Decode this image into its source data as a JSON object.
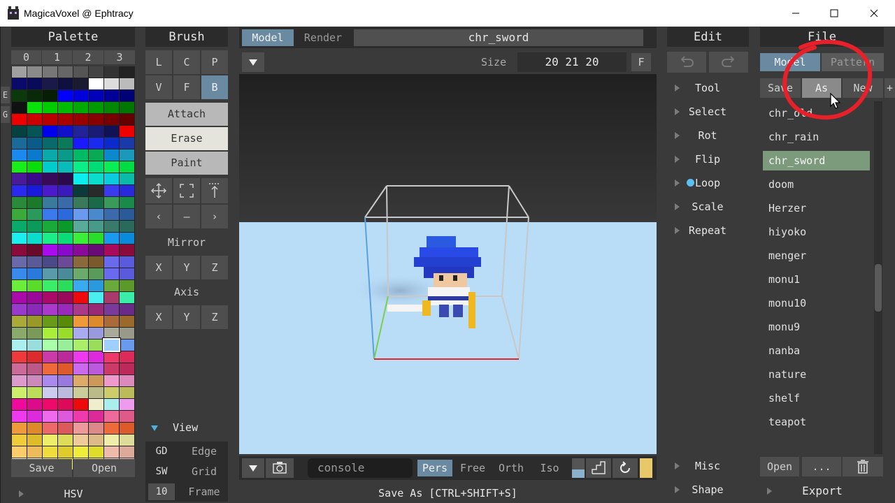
{
  "window": {
    "title": "MagicaVoxel @ Ephtracy"
  },
  "palette": {
    "title": "Palette",
    "tabs": [
      "0",
      "1",
      "2",
      "3"
    ],
    "side_tabs": [
      "E",
      "G"
    ],
    "colors": [
      [
        "#a0a0a0",
        "#8a8a8a",
        "#777777",
        "#666666",
        "#555555",
        "#444444",
        "#333333",
        "#222222"
      ],
      [
        "#0a0a6a",
        "#0a0a5a",
        "#1a1a4a",
        "#101040",
        "#1a1a30",
        "#ffffff",
        "#dddddd",
        "#bbbbbb"
      ],
      [
        "#0a3a0a",
        "#082a08",
        "#061e06",
        "#0000ff",
        "#0000dd",
        "#0000bb",
        "#000099",
        "#000077"
      ],
      [
        "#111111",
        "#0ae00a",
        "#00cc00",
        "#00bb00",
        "#00aa00",
        "#009900",
        "#008800",
        "#007700"
      ],
      [
        "#ee0000",
        "#cc0000",
        "#bb0000",
        "#aa0000",
        "#990000",
        "#880000",
        "#770000",
        "#660000"
      ],
      [
        "#064040",
        "#055555",
        "#0000ee",
        "#1111cc",
        "#222299",
        "#1a1a77",
        "#111155",
        "#ee0000"
      ],
      [
        "#1a6a9a",
        "#0a5a8a",
        "#086a6a",
        "#0a7a5a",
        "#1a1aff",
        "#1a2aee",
        "#0a2acc",
        "#1a3aaa"
      ],
      [
        "#1a8aee",
        "#0a7acc",
        "#0aaaaa",
        "#0a9a8a",
        "#00bb66",
        "#0aaa55",
        "#0a8acc",
        "#1a99bb"
      ],
      [
        "#1aee1a",
        "#0add0a",
        "#00cccc",
        "#0abbbb",
        "#0aee88",
        "#00dd77",
        "#0aee55",
        "#00dd44"
      ],
      [
        "#4a1a9a",
        "#3a0a8a",
        "#3a0a5a",
        "#2a0a4a",
        "#0aeeee",
        "#0addcc",
        "#0accdd",
        "#0abbaa"
      ],
      [
        "#2a2aee",
        "#1a1add",
        "#4a1acc",
        "#3a1abb",
        "#0a3a3a",
        "#2a2a2a",
        "#3a3aee",
        "#2a2add"
      ],
      [
        "#2a8a3a",
        "#1a7a2a",
        "#3a7a9a",
        "#3a6aaa",
        "#3a7a5a",
        "#1a6a4a",
        "#3a9a5a",
        "#1a8a4a"
      ],
      [
        "#3aaa3a",
        "#2a9a5a",
        "#3a7aee",
        "#2a6add",
        "#6a9aee",
        "#4a8acc",
        "#3a6aaa",
        "#2a5a99"
      ],
      [
        "#0aaa6a",
        "#0a9a5a",
        "#1aaa3a",
        "#0a9a2a",
        "#5aaa9a",
        "#4a9a8a",
        "#3a7a6a",
        "#2a6a5a"
      ],
      [
        "#1aeeee",
        "#0addcc",
        "#1aee88",
        "#0add77",
        "#3aee3a",
        "#2add2a",
        "#1a9aee",
        "#0a8add"
      ],
      [
        "#8a0a3a",
        "#6a0a2a",
        "#aa0aee",
        "#8a0acc",
        "#8a0a99",
        "#6a0a77",
        "#aa0a5a",
        "#8a0a3a"
      ],
      [
        "#6a6aaa",
        "#5a5a99",
        "#4a4a88",
        "#6a4a99",
        "#8a6a3a",
        "#7a5a2a",
        "#6a6aee",
        "#5a5add"
      ],
      [
        "#3a8aee",
        "#2a7add",
        "#5a9aaa",
        "#4a8a99",
        "#6aaa6a",
        "#5a9a5a",
        "#6a6aee",
        "#5a5add"
      ],
      [
        "#6aee3a",
        "#5add2a",
        "#3aee6a",
        "#2add5a",
        "#3aaaee",
        "#2a99dd",
        "#6aaa3a",
        "#5a992a"
      ],
      [
        "#aa0aaa",
        "#990a99",
        "#aa0a6a",
        "#990a5a",
        "#ee0a0a",
        "#4aeeee",
        "#aa3a6a",
        "#3aeeaa"
      ],
      [
        "#9a3acc",
        "#8a2abb",
        "#aa3acc",
        "#9a2abb",
        "#aa3a88",
        "#9a2a77",
        "#7a3a9a",
        "#6a2a88"
      ],
      [
        "#aaaa3a",
        "#99992a",
        "#6a9a1a",
        "#5a8a0a",
        "#ee9a3a",
        "#dd8a2a",
        "#aa6a3a",
        "#996a2a"
      ],
      [
        "#8aaa6a",
        "#7a9a5a",
        "#aaee3a",
        "#99dd2a",
        "#aaaaee",
        "#9999dd",
        "#aaaa9a",
        "#99998a"
      ],
      [
        "#aaeeee",
        "#99dddd",
        "#aaffaa",
        "#99ee99",
        "#aaee6a",
        "#99dd5a",
        "#9fcfff",
        "#6a9aee"
      ],
      [
        "#ee3a3a",
        "#dd2a2a",
        "#cc3aaa",
        "#bb2a99",
        "#ee3aee",
        "#dd2add",
        "#ee3a6a",
        "#dd2a5a"
      ],
      [
        "#cc6a9a",
        "#bb5a89",
        "#ee6a3a",
        "#dd5a2a",
        "#cc6aee",
        "#bb5add",
        "#cc3a6a",
        "#bb2a5a"
      ],
      [
        "#dd9acc",
        "#cc89bb",
        "#aa8aee",
        "#9979dd",
        "#ddaa6a",
        "#cc995a",
        "#ee9acc",
        "#dd89bb"
      ],
      [
        "#ccee6a",
        "#bbdd5a",
        "#ccccee",
        "#bbbbdd",
        "#cccc9a",
        "#bbbb89",
        "#cccc6a",
        "#bbbb5a"
      ],
      [
        "#ee0a9a",
        "#dd0a89",
        "#ee0a6a",
        "#dd0a5a",
        "#ee0a0a",
        "#eeeecc",
        "#aaeeee",
        "#ee9aee"
      ],
      [
        "#ee3aee",
        "#dd2add",
        "#ee6aee",
        "#dd5add",
        "#ee3aaa",
        "#dd2a99",
        "#ee6a9a",
        "#dd5a89"
      ],
      [
        "#ee9a3a",
        "#dd8a2a",
        "#ee6a6a",
        "#dd5a5a",
        "#ee9a9a",
        "#dd8989",
        "#ee6a3a",
        "#dd5a2a"
      ],
      [
        "#eecc3a",
        "#ddbb2a",
        "#eeee6a",
        "#dddd5a",
        "#eecc9a",
        "#ddbb89",
        "#eeeeaa",
        "#dddd99"
      ],
      [
        "#ffcc6a",
        "#eebb5a",
        "#eedd3a",
        "#ddcc2a",
        "#eeee3a",
        "#dddd2a",
        "#eebbaa",
        "#ddaa99"
      ],
      [
        "#ffffff",
        "#ffffee",
        "#eeeecc",
        "#ffff6a",
        "#ffeeaa",
        "#ffee99",
        "#ffdddd",
        "#eecccc"
      ]
    ],
    "selected": {
      "row": 23,
      "col": 6
    },
    "save_label": "Save",
    "open_label": "Open",
    "hsv_label": "HSV"
  },
  "brush": {
    "title": "Brush",
    "types_row1": [
      "L",
      "C",
      "P"
    ],
    "types_row2": [
      "V",
      "F",
      "B"
    ],
    "modes": [
      "Attach",
      "Erase",
      "Paint"
    ],
    "mirror_label": "Mirror",
    "axis_label": "Axis",
    "xyz": [
      "X",
      "Y",
      "Z"
    ],
    "view": {
      "label": "View",
      "rows": [
        {
          "key": "GD",
          "value": "Edge"
        },
        {
          "key": "SW",
          "value": "Grid"
        },
        {
          "key": "10",
          "value": "Frame"
        }
      ]
    }
  },
  "viewport": {
    "tab_model": "Model",
    "tab_render": "Render",
    "model_name": "chr_sword",
    "size_label": "Size",
    "size_value": "20 21 20",
    "fit_label": "F",
    "console_placeholder": "console",
    "cam_modes": [
      "Pers",
      "Free",
      "Orth",
      "Iso"
    ],
    "status": "Save As [CTRL+SHIFT+S]"
  },
  "edit": {
    "title": "Edit",
    "items": [
      "Tool",
      "Select",
      "Rot",
      "Flip",
      "Loop",
      "Scale",
      "Repeat"
    ],
    "bottom": [
      "Misc",
      "Shape"
    ]
  },
  "file": {
    "title": "File",
    "tab_model": "Model",
    "tab_pattern": "Pattern",
    "actions": [
      "Save",
      "As",
      "New",
      "+"
    ],
    "items": [
      "chr_old",
      "chr_rain",
      "chr_sword",
      "doom",
      "Herzer",
      "hiyoko",
      "menger",
      "monu1",
      "monu10",
      "monu9",
      "nanba",
      "nature",
      "shelf",
      "teapot"
    ],
    "selected": "chr_sword",
    "open_label": "Open",
    "more_label": "...",
    "export_label": "Export"
  },
  "colors": {
    "accent_selected": "#7c9a7c",
    "tab_active": "#6a8aa2",
    "sky": "#b9dcf7",
    "annotation": "#e8202a"
  }
}
